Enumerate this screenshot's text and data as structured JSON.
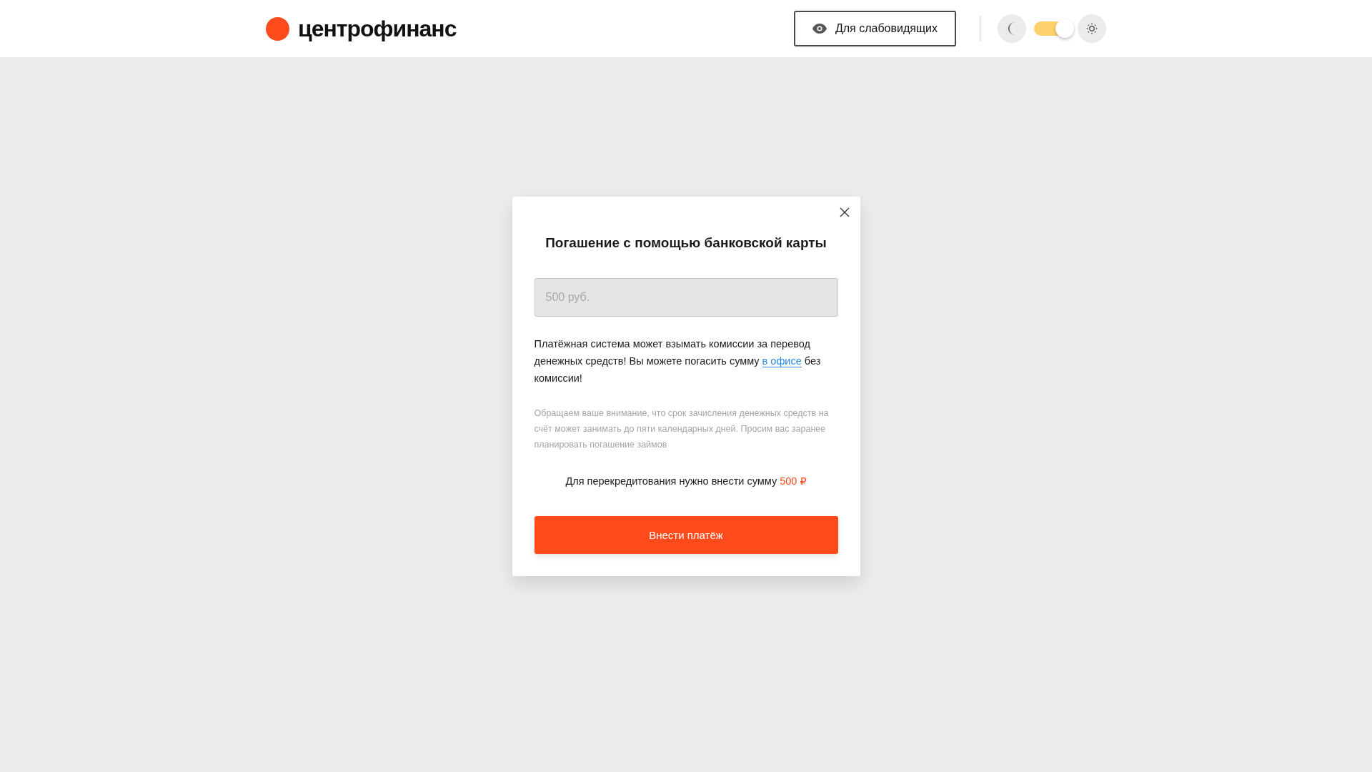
{
  "header": {
    "logo": "центрофинанс",
    "accessibility_button": "Для слабовидящих",
    "theme_toggle": {
      "on": true
    }
  },
  "modal": {
    "title": "Погашение с помощью банковской карты",
    "amount_field": {
      "placeholder": "500 руб."
    },
    "notice": {
      "before": "Платёжная система может взымать комиссии за перевод денежных средств! Вы можете погасить сумму ",
      "link": "в офисе",
      "after": " без комиссии!"
    },
    "note": "Обращаем ваше внимание, что срок зачисления денежных средств на счёт может занимать до пяти календарных дней. Просим вас заранее планировать погашение займов",
    "required_sum": {
      "text": "Для перекредитования нужно внести сумму",
      "amount": "500 ₽"
    },
    "submit_button": "Внести платёж"
  }
}
